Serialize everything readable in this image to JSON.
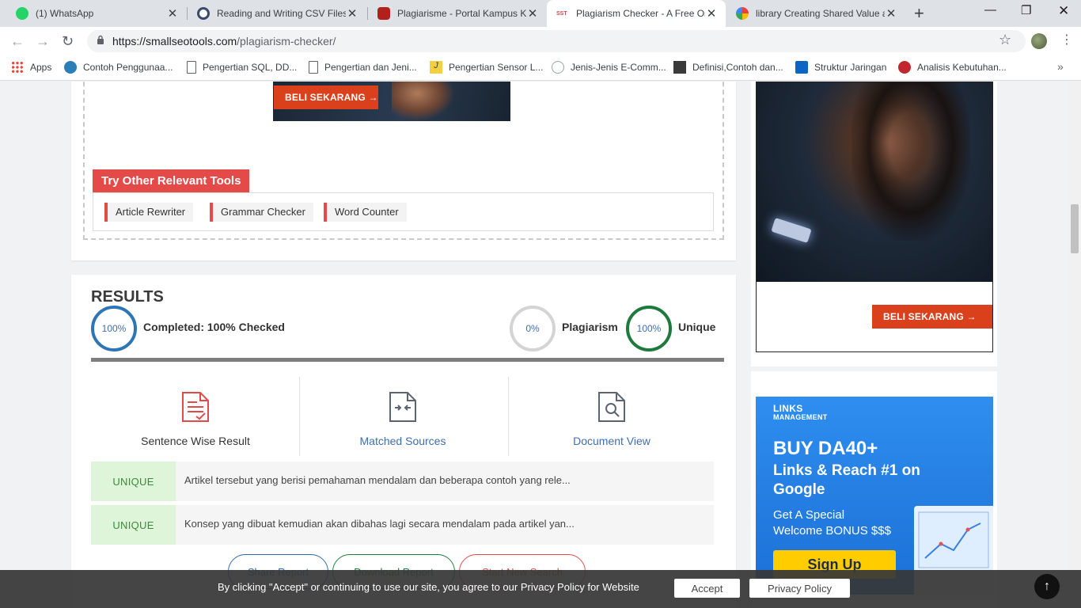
{
  "browser": {
    "tabs": [
      {
        "title": "(1) WhatsApp",
        "icon": "whatsapp-icon",
        "active": false
      },
      {
        "title": "Reading and Writing CSV Files",
        "icon": "globe-icon",
        "active": false
      },
      {
        "title": "Plagiarisme - Portal Kampus Ke",
        "icon": "campus-icon",
        "active": false
      },
      {
        "title": "Plagiarism Checker - A Free Or",
        "icon": "sst-icon",
        "favicon_text": "SST",
        "active": true
      },
      {
        "title": "library Creating Shared Value a",
        "icon": "google-icon",
        "active": false
      }
    ],
    "new_tab_label": "+",
    "window_controls": [
      "—",
      "❐",
      "✕"
    ],
    "url_host": "https://smallseotools.com",
    "url_path": "/plagiarism-checker/",
    "bookmarks": [
      {
        "label": "Apps",
        "icon": "apps-grid-icon"
      },
      {
        "label": "Contoh Penggunaa...",
        "icon": "wordpress-icon"
      },
      {
        "label": "Pengertian SQL, DD...",
        "icon": "page-icon"
      },
      {
        "label": "Pengertian dan Jeni...",
        "icon": "page-icon"
      },
      {
        "label": "Pengertian Sensor L...",
        "icon": "j-icon"
      },
      {
        "label": "Jenis-Jenis E-Comm...",
        "icon": "circle-icon"
      },
      {
        "label": "Definisi,Contoh dan...",
        "icon": "person-icon"
      },
      {
        "label": "Struktur Jaringan",
        "icon": "linkedin-icon"
      },
      {
        "label": "Analisis Kebutuhan...",
        "icon": "red-logo-icon"
      }
    ],
    "bookmarks_more": "»"
  },
  "ad_top": {
    "button_label": "BELI SEKARANG →"
  },
  "tools": {
    "heading": "Try Other Relevant Tools",
    "items": [
      "Article Rewriter",
      "Grammar Checker",
      "Word Counter"
    ]
  },
  "results": {
    "title": "RESULTS",
    "completed_percent": "100%",
    "completed_label": "Completed: 100% Checked",
    "completed_fraction": 1.0,
    "plagiarism_percent": "0%",
    "plagiarism_label": "Plagiarism",
    "unique_percent": "100%",
    "unique_label": "Unique",
    "views": [
      {
        "label": "Sentence Wise Result",
        "icon": "report-icon",
        "active": true
      },
      {
        "label": "Matched Sources",
        "icon": "compare-icon",
        "active": false
      },
      {
        "label": "Document View",
        "icon": "document-search-icon",
        "active": false
      }
    ],
    "rows": [
      {
        "tag": "UNIQUE",
        "text": "Artikel tersebut yang berisi pemahaman mendalam dan beberapa contoh yang rele..."
      },
      {
        "tag": "UNIQUE",
        "text": "Konsep yang dibuat kemudian akan dibahas lagi secara mendalam pada artikel yan..."
      }
    ],
    "actions": {
      "share": "Share Report",
      "download": "Download Report",
      "new_search": "Start New Search"
    }
  },
  "side_ad": {
    "button_label": "BELI SEKARANG →"
  },
  "banner2": {
    "logo_line1": "LINKS",
    "logo_line2": "MANAGEMENT",
    "headline": "BUY DA40+",
    "sub1": "Links & Reach #1 on",
    "sub2": "Google",
    "offer1": "Get A Special",
    "offer2": "Welcome BONUS $$$",
    "cta": "Sign Up"
  },
  "cookie": {
    "text": "By clicking \"Accept\" or continuing to use our site, you agree to our Privacy Policy for Website",
    "accept": "Accept",
    "privacy": "Privacy Policy",
    "back_to_top": "↑"
  },
  "colors": {
    "accent_red": "#e34a48",
    "buy_orange": "#d9401b",
    "link_blue": "#3f6fae",
    "unique_green": "#1e7a3c",
    "completed_blue": "#2e75b6"
  }
}
